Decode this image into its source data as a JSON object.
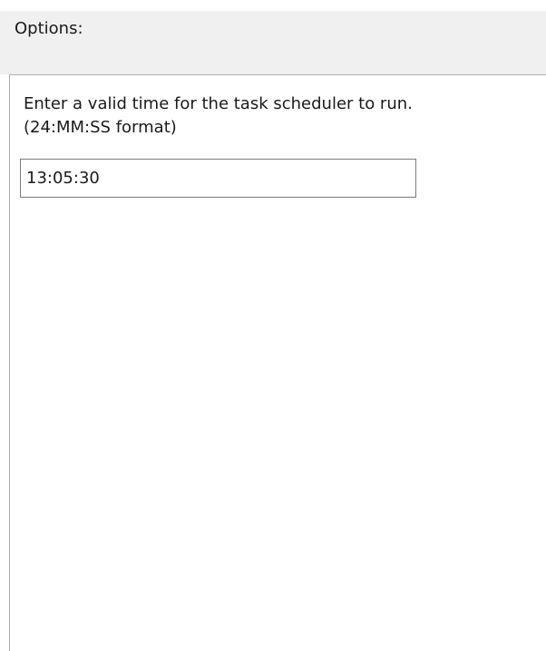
{
  "options": {
    "title": "Options:"
  },
  "scheduler": {
    "instruction_line1": "Enter a valid time for the task scheduler to run.",
    "instruction_line2": "(24:MM:SS format)",
    "time_value": "13:05:30"
  }
}
